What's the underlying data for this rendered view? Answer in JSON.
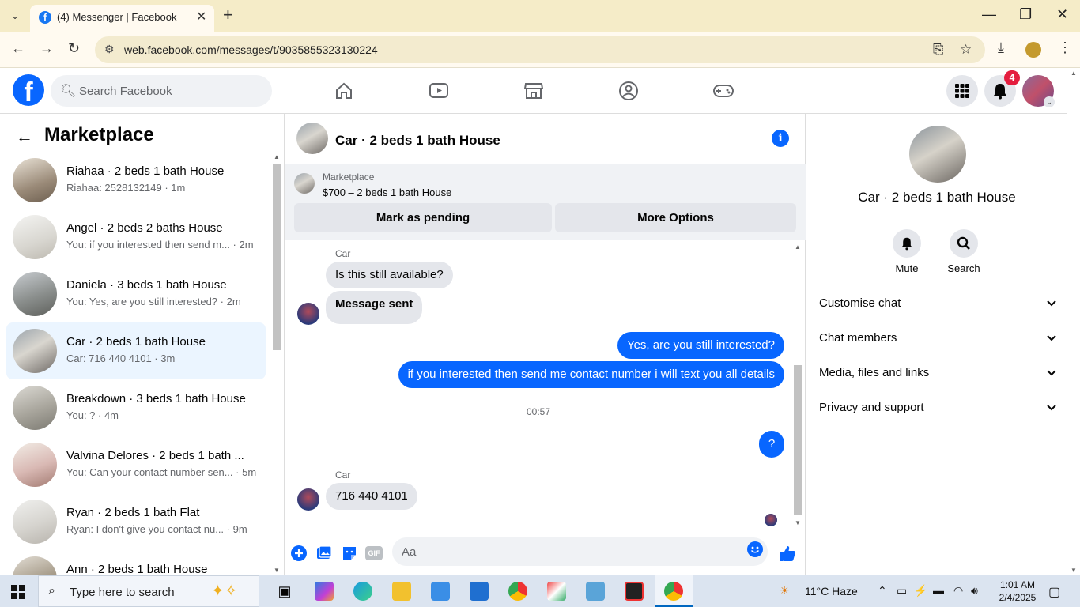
{
  "browser": {
    "tab_title": "(4) Messenger | Facebook",
    "url": "web.facebook.com/messages/t/9035855323130224"
  },
  "fb": {
    "search_placeholder": "Search Facebook",
    "notification_count": "4"
  },
  "left": {
    "title": "Marketplace",
    "conversations": [
      {
        "name": "Riahaa · 2 beds 1 bath House",
        "preview": "Riahaa: 2528132149 · 1m",
        "active": false
      },
      {
        "name": "Angel · 2 beds 2 baths House",
        "preview": "You: if you interested then send m... · 2m",
        "active": false
      },
      {
        "name": "Daniela · 3 beds 1 bath House",
        "preview": "You: Yes, are you still interested? · 2m",
        "active": false
      },
      {
        "name": "Car · 2 beds 1 bath House",
        "preview": "Car: 716 440 4101 · 3m",
        "active": true
      },
      {
        "name": "Breakdown · 3 beds 1 bath House",
        "preview": "You: ? · 4m",
        "active": false
      },
      {
        "name": "Valvina Delores · 2 beds 1 bath ...",
        "preview": "You: Can your contact number sen... · 5m",
        "active": false
      },
      {
        "name": "Ryan · 2 beds 1 bath Flat",
        "preview": "Ryan: I don't give you contact nu... · 9m",
        "active": false
      },
      {
        "name": "Ann · 2 beds 1 bath House",
        "preview": "",
        "active": false
      }
    ]
  },
  "chat": {
    "title": "Car · 2 beds 1 bath House",
    "marketplace_label": "Marketplace",
    "listing": "$700 – 2 beds 1 bath House",
    "mark_pending_label": "Mark as pending",
    "more_options_label": "More Options",
    "messages": {
      "sender1": "Car",
      "in1": "Is this still available?",
      "in2": "Message sent",
      "out1": "Yes, are you still interested?",
      "out2": "if you interested then send me contact number i will text you all details",
      "timestamp": "00:57",
      "out3": "?",
      "sender2": "Car",
      "in3": "716 440 4101"
    },
    "composer_placeholder": "Aa",
    "gif_label": "GIF"
  },
  "right": {
    "name": "Car · 2 beds 1 bath House",
    "mute_label": "Mute",
    "search_label": "Search",
    "sections": [
      "Customise chat",
      "Chat members",
      "Media, files and links",
      "Privacy and support"
    ]
  },
  "taskbar": {
    "search_text": "Type here to search",
    "weather": "11°C  Haze",
    "time": "1:01 AM",
    "date": "2/4/2025"
  },
  "colors": {
    "fb_blue": "#0866ff",
    "outgoing_bubble": "#0866ff",
    "incoming_bubble": "#e4e6eb",
    "active_conv": "#ebf5ff",
    "tab_strip": "#f5ecc8"
  }
}
